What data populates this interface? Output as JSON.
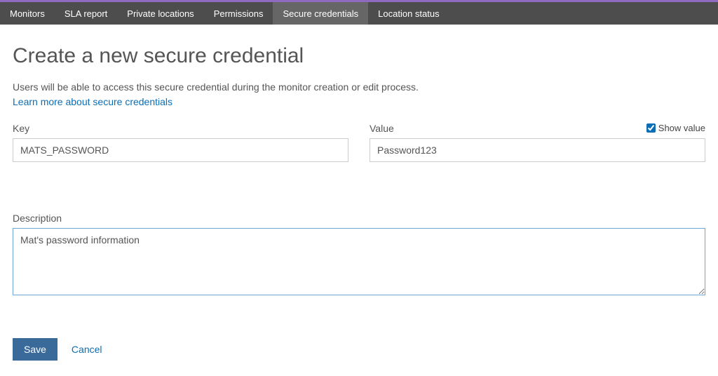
{
  "nav": {
    "items": [
      {
        "label": "Monitors",
        "active": false
      },
      {
        "label": "SLA report",
        "active": false
      },
      {
        "label": "Private locations",
        "active": false
      },
      {
        "label": "Permissions",
        "active": false
      },
      {
        "label": "Secure credentials",
        "active": true
      },
      {
        "label": "Location status",
        "active": false
      }
    ]
  },
  "page": {
    "title": "Create a new secure credential",
    "subtitle": "Users will be able to access this secure credential during the monitor creation or edit process.",
    "learn_more": "Learn more about secure credentials"
  },
  "form": {
    "key_label": "Key",
    "key_value": "MATS_PASSWORD",
    "value_label": "Value",
    "value_value": "Password123",
    "show_value_label": "Show value",
    "show_value_checked": true,
    "description_label": "Description",
    "description_value": "Mat's password information"
  },
  "actions": {
    "save": "Save",
    "cancel": "Cancel"
  }
}
